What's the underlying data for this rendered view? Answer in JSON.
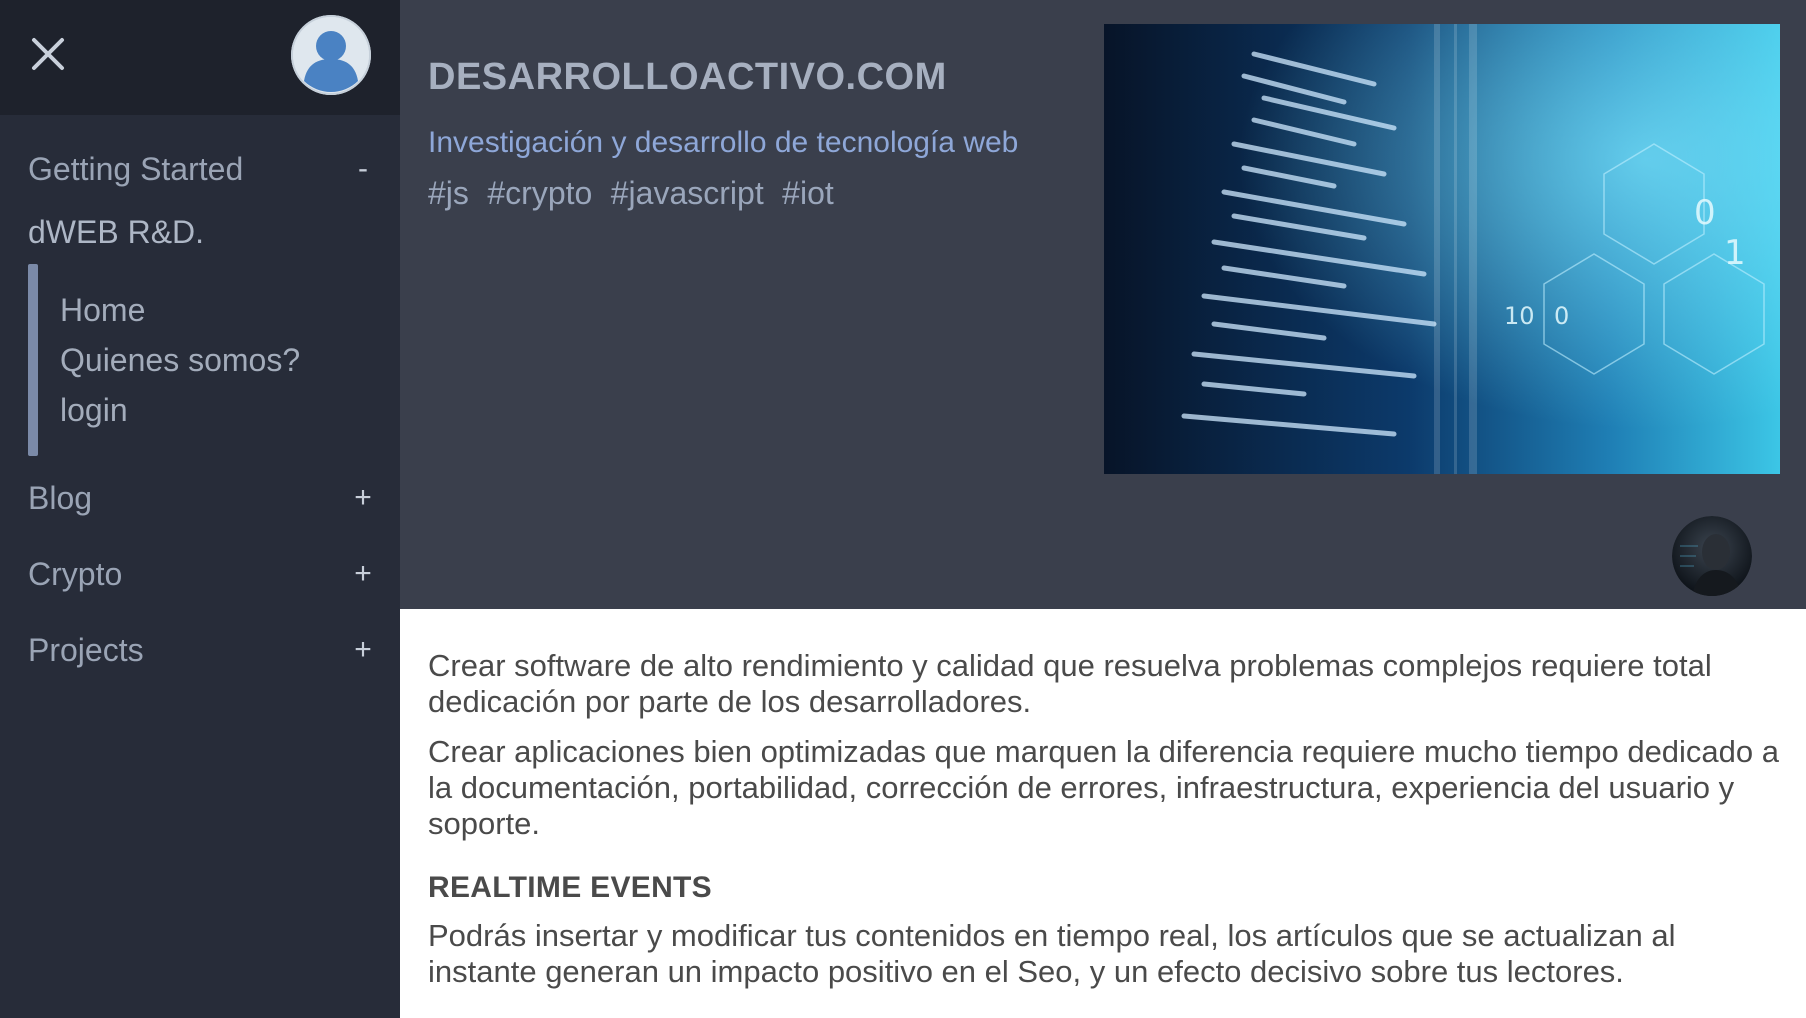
{
  "sidebar": {
    "close_icon": "close-icon",
    "avatar_icon": "user-avatar-icon",
    "items": [
      {
        "label": "Getting Started",
        "toggle": "-"
      },
      {
        "label": "Blog",
        "toggle": "+"
      },
      {
        "label": "Crypto",
        "toggle": "+"
      },
      {
        "label": "Projects",
        "toggle": "+"
      }
    ],
    "section_title": "dWEB R&D.",
    "sub_links": [
      "Home",
      "Quienes somos?",
      "login"
    ]
  },
  "header": {
    "title": "DESARROLLOACTIVO.COM",
    "subtitle": "Investigación y desarrollo de tecnología web",
    "tags": [
      "#js",
      "#crypto",
      "#javascript",
      "#iot"
    ]
  },
  "content": {
    "paragraph1": "Crear software de alto rendimiento y calidad que resuelva problemas complejos requiere total dedicación por parte de los desarrolladores.",
    "paragraph2": "Crear aplicaciones bien optimizadas que marquen la diferencia requiere mucho tiempo dedicado a la documentación, portabilidad, corrección de errores, infraestructura, experiencia del usuario y soporte.",
    "heading": "REALTIME EVENTS",
    "paragraph3": "Podrás insertar y modificar tus contenidos en tiempo real, los artículos que se actualizan al instante generan un impacto positivo en el Seo, y un efecto decisivo sobre tus lectores."
  },
  "colors": {
    "sidebar_bg": "#272c39",
    "header_bg": "#3a3f4c",
    "accent": "#8ea7d8"
  }
}
